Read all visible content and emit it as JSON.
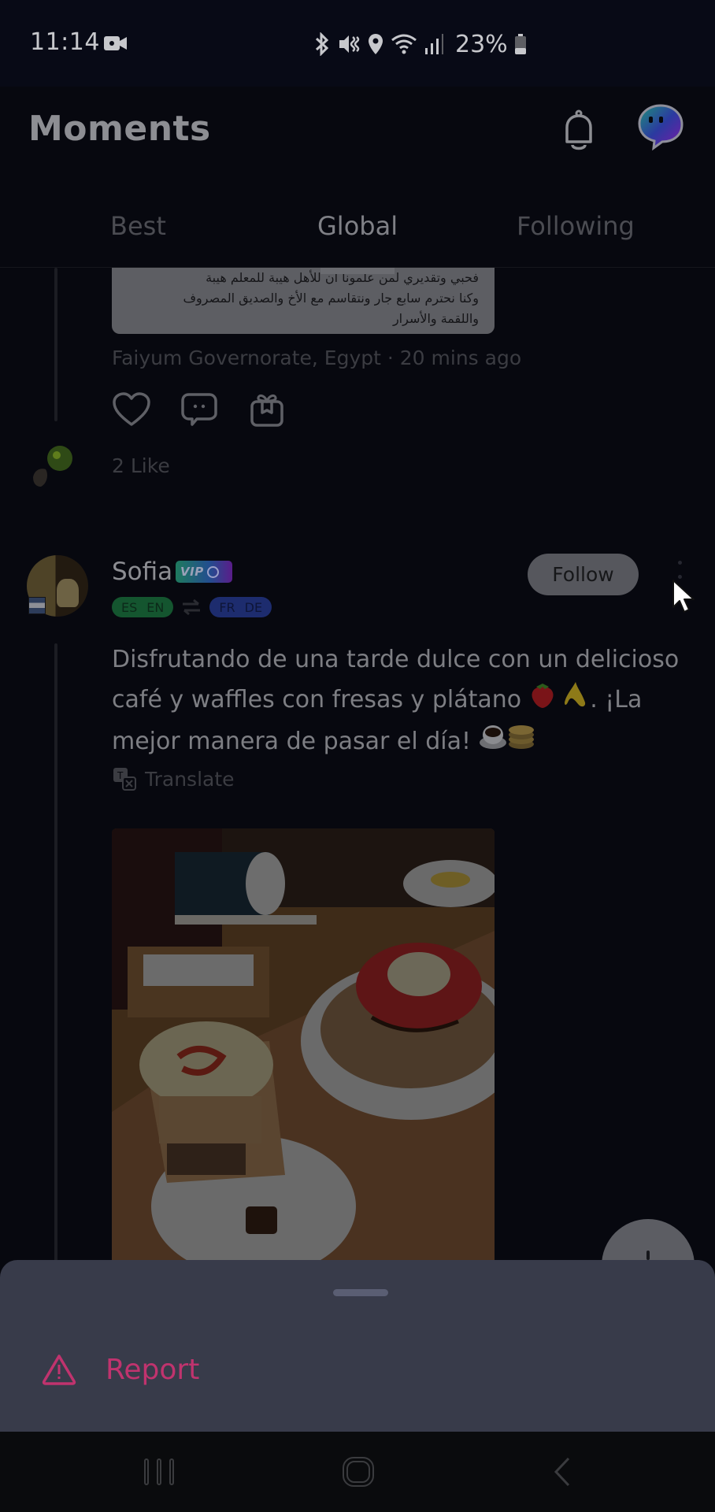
{
  "status_bar": {
    "time": "11:14",
    "battery": "23%",
    "icons": [
      "screen-record-icon",
      "bluetooth-icon",
      "vibrate-mute-icon",
      "location-icon",
      "wifi-icon",
      "signal-icon",
      "battery-icon"
    ]
  },
  "app_bar": {
    "title": "Moments",
    "icons": [
      "bell-icon",
      "chat-logo-icon"
    ]
  },
  "tabs": [
    {
      "label": "Best",
      "active": false
    },
    {
      "label": "Global",
      "active": true
    },
    {
      "label": "Following",
      "active": false
    }
  ],
  "previous_post": {
    "text_lines": [
      "فحبي وتقديري لمن علمونا أن للأهل هيبة للمعلم هيبة",
      "وكنا نحترم سابع جار ونتقاسم مع الأخ والصديق المصروف",
      "واللقمة والأسرار"
    ],
    "location": "Faiyum Governorate, Egypt",
    "time_ago": "20 mins ago",
    "meta_separator": " · ",
    "actions": [
      "like",
      "comment",
      "gift"
    ],
    "likes_label": "2 Like"
  },
  "post": {
    "username": "Sofia",
    "vip_label": "VIP",
    "native_languages": [
      "ES",
      "EN"
    ],
    "learning_languages": [
      "FR",
      "DE"
    ],
    "follow_label": "Follow",
    "text": "Disfrutando de una tarde dulce con un delicioso café y waffles con fresas y plátano 🍓🍌. ¡La mejor manera de pasar el día! ☕🥞",
    "text_main": "Disfrutando de una tarde dulce con un delicioso café y waffles con fresas y plátano",
    "text_emoji_1": "🍓",
    "text_emoji_2": "🍌",
    "text_tail": ". ¡La mejor manera de pasar el día!",
    "text_emoji_3": "☕",
    "text_emoji_4": "🥞",
    "translate_label": "Translate",
    "photo_description": "Latte with caramel drizzle and waffles topped with strawberries, bananas and chocolate sauce"
  },
  "bottom_sheet": {
    "items": [
      {
        "label": "Report",
        "icon": "warning-icon"
      }
    ]
  },
  "colors": {
    "accent_report": "#c0336e",
    "sheet_bg": "#383b4a",
    "native_lang": "#14552f",
    "learning_lang": "#1d2c6e"
  },
  "nav_bar": {
    "buttons": [
      "recents",
      "home",
      "back"
    ]
  }
}
